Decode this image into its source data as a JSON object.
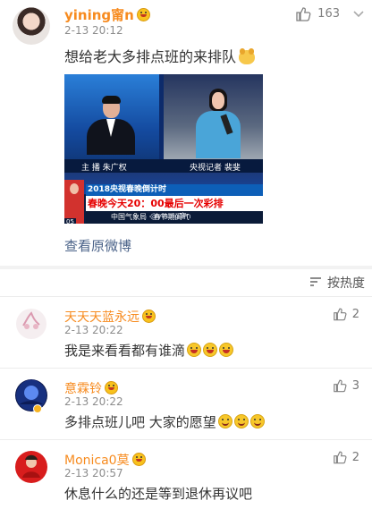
{
  "post": {
    "username": "yining甯n",
    "timestamp": "2-13 20:12",
    "likes": "163",
    "text": "想给老大多排点班的来排队",
    "view_original": "查看原微博",
    "media": {
      "caption_left": "主 播 朱广权",
      "caption_right": "央视记者 裴斐",
      "headline_top": "2018央视春晚倒计时",
      "headline_main_prefix": "春晚今天20：",
      "headline_main_highlight": "00最后一次彩排",
      "ticker": "中国气象局 · 春节期间气",
      "watermark": "@yining甯n",
      "clock": "05"
    }
  },
  "sort": {
    "label": "按热度"
  },
  "comments": [
    {
      "name": "天天天蓝永远",
      "time": "2-13 20:22",
      "text": "我是来看看都有谁滴",
      "likes": "2",
      "emoji_count": 3
    },
    {
      "name": "意霖铃",
      "time": "2-13 20:22",
      "text": "多排点班儿吧 大家的愿望",
      "likes": "3",
      "emoji_count": 3
    },
    {
      "name": "Monica0莫",
      "time": "2-13 20:57",
      "text": "休息什么的还是等到退休再议吧",
      "likes": "2",
      "emoji_count": 0
    }
  ],
  "colors": {
    "username": "#f78b1f",
    "link": "#4a6288",
    "muted": "#8d8d8d"
  }
}
